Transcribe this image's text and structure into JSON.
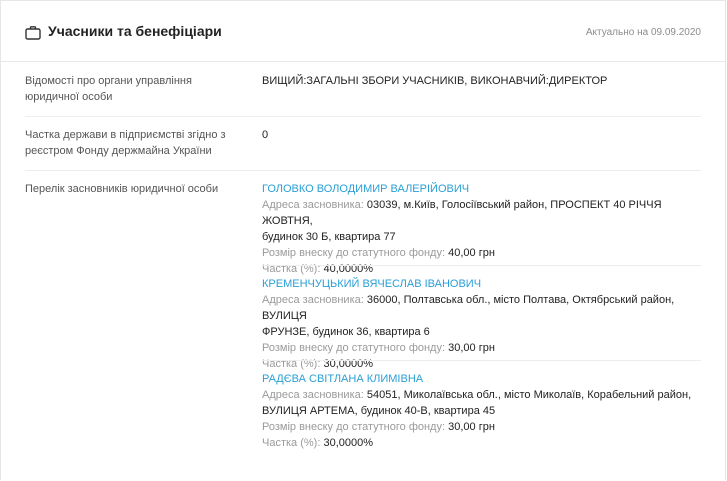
{
  "header": {
    "title": "Учасники та бенефіціари",
    "date_text": "Актуально на 09.09.2020"
  },
  "rows": {
    "management": {
      "label": "Відомості про органи управління юридичної особи",
      "value": "ВИЩИЙ:ЗАГАЛЬНІ ЗБОРИ УЧАСНИКІВ, ВИКОНАВЧИЙ:ДИРЕКТОР"
    },
    "state_share": {
      "label": "Частка держави в підприємстві згідно з реєстром Фонду держмайна України",
      "value": "0"
    },
    "founders": {
      "label": "Перелік засновників юридичної особи"
    }
  },
  "founder_labels": {
    "address": "Адреса засновника:",
    "contribution": "Розмір внеску до статутного фонду:",
    "share": "Частка (%):"
  },
  "founders": [
    {
      "name": "ГОЛОВКО ВОЛОДИМИР ВАЛЕРІЙОВИЧ",
      "address_line1": "03039, м.Київ, Голосіївський район, ПРОСПЕКТ 40 РІЧЧЯ ЖОВТНЯ,",
      "address_line2": "будинок 30 Б, квартира 77",
      "contribution": "40,00 грн",
      "share": "40,0000%"
    },
    {
      "name": "КРЕМЕНЧУЦЬКИЙ ВЯЧЕСЛАВ ІВАНОВИЧ",
      "address_line1": "36000, Полтавська обл., місто Полтава, Октябрський район, ВУЛИЦЯ",
      "address_line2": "ФРУНЗЕ, будинок 36, квартира 6",
      "contribution": "30,00 грн",
      "share": "30,0000%"
    },
    {
      "name": "РАДЄВА СВІТЛАНА КЛИМІВНА",
      "address_line1": "54051, Миколаївська обл., місто Миколаїв, Корабельний район,",
      "address_line2": "ВУЛИЦЯ АРТЕМА, будинок 40-В, квартира 45",
      "contribution": "30,00 грн",
      "share": "30,0000%"
    }
  ]
}
